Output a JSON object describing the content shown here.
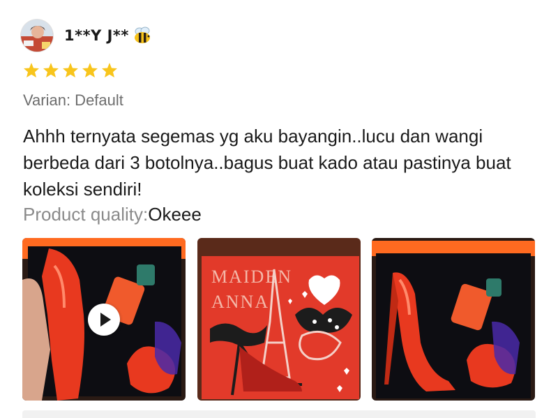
{
  "review": {
    "username": "1**Y J**",
    "username_emoji": "bee-icon",
    "rating": 5,
    "rating_max": 5,
    "variant_label": "Varian: Default",
    "text": "Ahhh ternyata segemas yg aku bayangin..lucu dan wangi berbeda dari 3 botolnya..bagus buat kado atau pastinya buat koleksi sendiri!",
    "quality_label": "Product quality:",
    "quality_value": "Okeee"
  },
  "media": [
    {
      "type": "video",
      "icon": "play-icon"
    },
    {
      "type": "image",
      "box_text_line1": "MAIDEN",
      "box_text_line2": "ANNA"
    },
    {
      "type": "image"
    }
  ],
  "colors": {
    "star": "#f8c51c",
    "text": "#1a1a1a",
    "muted": "#6d6d6d",
    "product_red": "#e8391f"
  }
}
